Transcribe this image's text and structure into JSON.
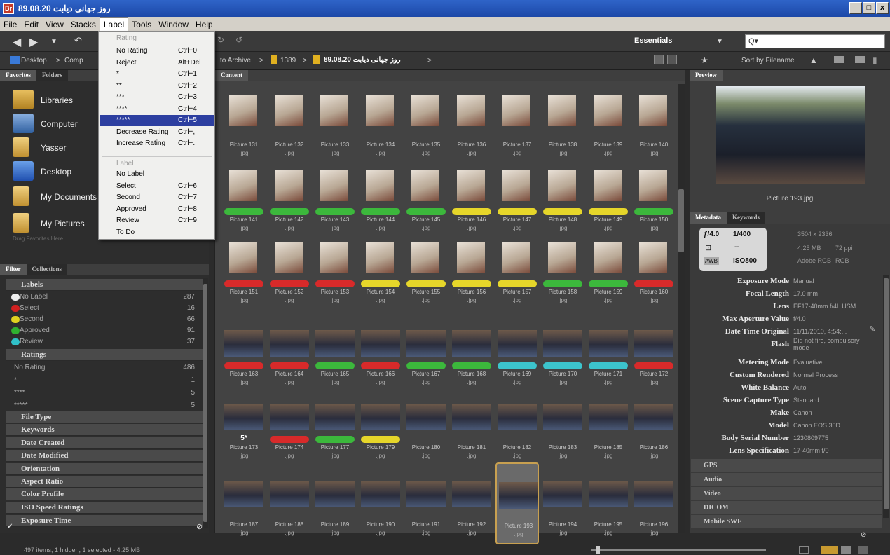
{
  "window": {
    "title": "روز جهانی دیابت 89.08.20",
    "icon": "Br",
    "minimize": "_",
    "maximize": "□",
    "close": "x"
  },
  "menubar": {
    "items": [
      "File",
      "Edit",
      "View",
      "Stacks",
      "Label",
      "Tools",
      "Window",
      "Help"
    ]
  },
  "toolbar": {
    "workspace": "Essentials",
    "search_placeholder": "Q▾"
  },
  "path": {
    "items": [
      "Desktop",
      "Comp",
      "to Archive",
      "1389",
      "89.08.20 روز جهانی دیابت"
    ],
    "sort": "Sort by Filename"
  },
  "label_menu": {
    "rating_header": "Rating",
    "items": [
      {
        "label": "No Rating",
        "shortcut": "Ctrl+0"
      },
      {
        "label": "Reject",
        "shortcut": "Alt+Del"
      },
      {
        "label": "*",
        "shortcut": "Ctrl+1"
      },
      {
        "label": "**",
        "shortcut": "Ctrl+2"
      },
      {
        "label": "***",
        "shortcut": "Ctrl+3"
      },
      {
        "label": "****",
        "shortcut": "Ctrl+4"
      },
      {
        "label": "*****",
        "shortcut": "Ctrl+5"
      },
      {
        "label": "Decrease Rating",
        "shortcut": "Ctrl+,"
      },
      {
        "label": "Increase Rating",
        "shortcut": "Ctrl+."
      }
    ],
    "label_header": "Label",
    "label_items": [
      {
        "label": "No Label",
        "shortcut": ""
      },
      {
        "label": "Select",
        "shortcut": "Ctrl+6"
      },
      {
        "label": "Second",
        "shortcut": "Ctrl+7"
      },
      {
        "label": "Approved",
        "shortcut": "Ctrl+8"
      },
      {
        "label": "Review",
        "shortcut": "Ctrl+9"
      },
      {
        "label": "To Do",
        "shortcut": ""
      }
    ]
  },
  "favorites": {
    "tabs": [
      "Favorites",
      "Folders"
    ],
    "items": [
      "Libraries",
      "Computer",
      "Yasser",
      "Desktop",
      "My Documents",
      "My Pictures"
    ],
    "hint": "Drag Favorites Here..."
  },
  "filter": {
    "tabs": [
      "Filter",
      "Collections"
    ],
    "labels_header": "Labels",
    "labels": [
      {
        "name": "No Label",
        "count": "287",
        "color": "#ffffff"
      },
      {
        "name": "Select",
        "count": "16",
        "color": "#d02020"
      },
      {
        "name": "Second",
        "count": "66",
        "color": "#e0d020"
      },
      {
        "name": "Approved",
        "count": "91",
        "color": "#30b030"
      },
      {
        "name": "Review",
        "count": "37",
        "color": "#30c0c8"
      }
    ],
    "ratings_header": "Ratings",
    "ratings": [
      {
        "name": "No Rating",
        "count": "486"
      },
      {
        "name": "*",
        "count": "1"
      },
      {
        "name": "****",
        "count": "5"
      },
      {
        "name": "*****",
        "count": "5"
      }
    ],
    "sections": [
      "File Type",
      "Keywords",
      "Date Created",
      "Date Modified",
      "Orientation",
      "Aspect Ratio",
      "Color Profile",
      "ISO Speed Ratings",
      "Exposure Time"
    ]
  },
  "content": {
    "tab": "Content",
    "rows": [
      {
        "names": [
          "Picture 131",
          "Picture 132",
          "Picture 133",
          "Picture 134",
          "Picture 135",
          "Picture 136",
          "Picture 137",
          "Picture 138",
          "Picture 139",
          "Picture 140"
        ],
        "labels": [
          "",
          "",
          "",
          "",
          "",
          "",
          "",
          "",
          "",
          ""
        ],
        "wide": false
      },
      {
        "names": [
          "Picture 141",
          "Picture 142",
          "Picture 143",
          "Picture 144",
          "Picture 145",
          "Picture 146",
          "Picture 147",
          "Picture 148",
          "Picture 149",
          "Picture 150"
        ],
        "labels": [
          "#3cb83c",
          "#3cb83c",
          "#3cb83c",
          "#3cb83c",
          "#3cb83c",
          "#e6d62a",
          "#e6d62a",
          "#e6d62a",
          "#e6d62a",
          "#3cb83c"
        ],
        "wide": false
      },
      {
        "names": [
          "Picture 151",
          "Picture 152",
          "Picture 153",
          "Picture 154",
          "Picture 155",
          "Picture 156",
          "Picture 157",
          "Picture 158",
          "Picture 159",
          "Picture 160"
        ],
        "labels": [
          "#d82a2a",
          "#d82a2a",
          "#d82a2a",
          "#e6d62a",
          "#e6d62a",
          "#e6d62a",
          "#e6d62a",
          "#3cb83c",
          "#3cb83c",
          "#d82a2a"
        ],
        "wide": false
      },
      {
        "names": [
          "Picture 163",
          "Picture 164",
          "Picture 165",
          "Picture 166",
          "Picture 167",
          "Picture 168",
          "Picture 169",
          "Picture 170",
          "Picture 171",
          "Picture 172"
        ],
        "labels": [
          "#d82a2a",
          "#d82a2a",
          "#3cb83c",
          "#d82a2a",
          "#3cb83c",
          "#3cb83c",
          "#3cc4cc",
          "#3cc4cc",
          "#3cc4cc",
          "#d82a2a"
        ],
        "wide": true
      },
      {
        "names": [
          "Picture 173",
          "Picture 174",
          "Picture 177",
          "Picture 179",
          "Picture 180",
          "Picture 181",
          "Picture 182",
          "Picture 183",
          "Picture 185",
          "Picture 186"
        ],
        "labels": [
          "",
          "#d82a2a",
          "#3cb83c",
          "#e6d62a",
          "",
          "",
          "",
          "",
          "",
          ""
        ],
        "wide": true,
        "stars": "5*"
      },
      {
        "names": [
          "Picture 187",
          "Picture 188",
          "Picture 189",
          "Picture 190",
          "Picture 191",
          "Picture 192",
          "Picture 193",
          "Picture 194",
          "Picture 195",
          "Picture 196"
        ],
        "labels": [
          "",
          "",
          "",
          "",
          "",
          "",
          "",
          "",
          "",
          ""
        ],
        "wide": true,
        "selected": 6
      }
    ],
    "ext": ".jpg"
  },
  "preview": {
    "tab": "Preview",
    "filename": "Picture 193.jpg"
  },
  "metadata": {
    "tabs": [
      "Metadata",
      "Keywords"
    ],
    "aperture": "ƒ/4.0",
    "shutter": "1/400",
    "metering": "--",
    "iso": "ISO800",
    "dimensions": "3504 x 2336",
    "size": "4.25 MB",
    "ppi": "72 ppi",
    "colorspace": "Adobe RGB",
    "mode": "RGB",
    "fields": [
      {
        "k": "Exposure Mode",
        "v": "Manual"
      },
      {
        "k": "Focal Length",
        "v": "17.0 mm"
      },
      {
        "k": "Lens",
        "v": "EF17-40mm f/4L USM"
      },
      {
        "k": "Max Aperture Value",
        "v": "f/4.0"
      },
      {
        "k": "Date Time Original",
        "v": "11/11/2010, 4:54:..."
      },
      {
        "k": "Flash",
        "v": "Did not fire, compulsory mode"
      },
      {
        "k": "Metering Mode",
        "v": "Evaluative"
      },
      {
        "k": "Custom Rendered",
        "v": "Normal Process"
      },
      {
        "k": "White Balance",
        "v": "Auto"
      },
      {
        "k": "Scene Capture Type",
        "v": "Standard"
      },
      {
        "k": "Make",
        "v": "Canon"
      },
      {
        "k": "Model",
        "v": "Canon EOS 30D"
      },
      {
        "k": "Body Serial Number",
        "v": "1230809775"
      },
      {
        "k": "Lens Specification",
        "v": "17-40mm f/0"
      }
    ],
    "sections": [
      "GPS",
      "Audio",
      "Video",
      "DICOM",
      "Mobile SWF"
    ]
  },
  "status": {
    "text": "497 items, 1 hidden, 1 selected - 4.25 MB"
  }
}
